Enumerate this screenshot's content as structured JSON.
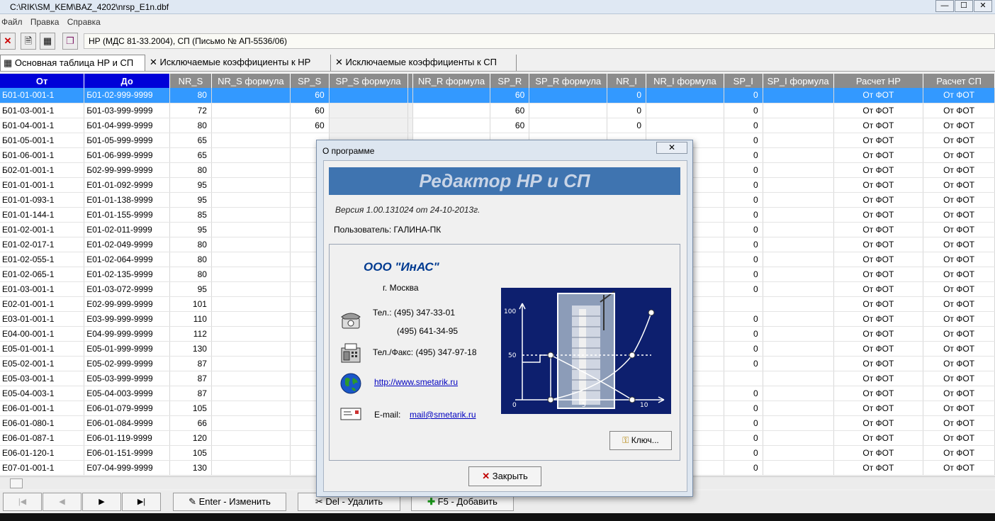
{
  "window": {
    "title": "C:\\RIK\\SM_KEM\\BAZ_4202\\nrsp_E1n.dbf"
  },
  "menu": [
    "Файл",
    "Правка",
    "Справка"
  ],
  "toolbar": {
    "field_value": "НР (МДС 81-33.2004), СП (Письмо № АП-5536/06)"
  },
  "tabs": [
    "Основная таблица НР и СП",
    "Исключаемые коэффициенты к НР",
    "Исключаемые коэффициенты к СП"
  ],
  "columns": [
    "От",
    "До",
    "NR_S",
    "NR_S формула",
    "SP_S",
    "SP_S формула",
    "NR_R формула",
    "SP_R",
    "SP_R формула",
    "NR_I",
    "NR_I формула",
    "SP_I",
    "SP_I формула",
    "Расчет НР",
    "Расчет СП"
  ],
  "rows": [
    {
      "from": "Б01-01-001-1",
      "to": "Б01-02-999-9999",
      "nrs": "80",
      "sps": "60",
      "spr": "60",
      "nri": "0",
      "spi": "0",
      "hr": "От ФОТ",
      "sp": "От ФОТ"
    },
    {
      "from": "Б01-03-001-1",
      "to": "Б01-03-999-9999",
      "nrs": "72",
      "sps": "60",
      "spr": "60",
      "nri": "0",
      "spi": "0",
      "hr": "От ФОТ",
      "sp": "От ФОТ"
    },
    {
      "from": "Б01-04-001-1",
      "to": "Б01-04-999-9999",
      "nrs": "80",
      "sps": "60",
      "spr": "60",
      "nri": "0",
      "spi": "0",
      "hr": "От ФОТ",
      "sp": "От ФОТ"
    },
    {
      "from": "Б01-05-001-1",
      "to": "Б01-05-999-9999",
      "nrs": "65",
      "sps": "",
      "spr": "",
      "nri": "",
      "spi": "0",
      "hr": "От ФОТ",
      "sp": "От ФОТ"
    },
    {
      "from": "Б01-06-001-1",
      "to": "Б01-06-999-9999",
      "nrs": "65",
      "sps": "",
      "spr": "",
      "nri": "",
      "spi": "0",
      "hr": "От ФОТ",
      "sp": "От ФОТ"
    },
    {
      "from": "Б02-01-001-1",
      "to": "Б02-99-999-9999",
      "nrs": "80",
      "sps": "",
      "spr": "",
      "nri": "",
      "spi": "0",
      "hr": "От ФОТ",
      "sp": "От ФОТ"
    },
    {
      "from": "Е01-01-001-1",
      "to": "Е01-01-092-9999",
      "nrs": "95",
      "sps": "",
      "spr": "",
      "nri": "",
      "spi": "0",
      "hr": "От ФОТ",
      "sp": "От ФОТ"
    },
    {
      "from": "Е01-01-093-1",
      "to": "Е01-01-138-9999",
      "nrs": "95",
      "sps": "",
      "spr": "",
      "nri": "",
      "spi": "0",
      "hr": "От ФОТ",
      "sp": "От ФОТ"
    },
    {
      "from": "Е01-01-144-1",
      "to": "Е01-01-155-9999",
      "nrs": "85",
      "sps": "",
      "spr": "",
      "nri": "",
      "spi": "0",
      "hr": "От ФОТ",
      "sp": "От ФОТ"
    },
    {
      "from": "Е01-02-001-1",
      "to": "Е01-02-011-9999",
      "nrs": "95",
      "sps": "",
      "spr": "",
      "nri": "",
      "spi": "0",
      "hr": "От ФОТ",
      "sp": "От ФОТ"
    },
    {
      "from": "Е01-02-017-1",
      "to": "Е01-02-049-9999",
      "nrs": "80",
      "sps": "",
      "spr": "",
      "nri": "",
      "spi": "0",
      "hr": "От ФОТ",
      "sp": "От ФОТ"
    },
    {
      "from": "Е01-02-055-1",
      "to": "Е01-02-064-9999",
      "nrs": "80",
      "sps": "",
      "spr": "",
      "nri": "",
      "spi": "0",
      "hr": "От ФОТ",
      "sp": "От ФОТ"
    },
    {
      "from": "Е01-02-065-1",
      "to": "Е01-02-135-9999",
      "nrs": "80",
      "sps": "",
      "spr": "",
      "nri": "",
      "spi": "0",
      "hr": "От ФОТ",
      "sp": "От ФОТ"
    },
    {
      "from": "Е01-03-001-1",
      "to": "Е01-03-072-9999",
      "nrs": "95",
      "sps": "",
      "spr": "",
      "nri": "",
      "spi": "0",
      "hr": "От ФОТ",
      "sp": "От ФОТ"
    },
    {
      "from": "Е02-01-001-1",
      "to": "Е02-99-999-9999",
      "nrs": "101",
      "sps": "",
      "spr": "",
      "nri": "",
      "spi": "",
      "hr": "От ФОТ",
      "sp": "От ФОТ"
    },
    {
      "from": "Е03-01-001-1",
      "to": "Е03-99-999-9999",
      "nrs": "110",
      "sps": "",
      "spr": "",
      "nri": "",
      "spi": "0",
      "hr": "От ФОТ",
      "sp": "От ФОТ"
    },
    {
      "from": "Е04-00-001-1",
      "to": "Е04-99-999-9999",
      "nrs": "112",
      "sps": "",
      "spr": "",
      "nri": "",
      "spi": "0",
      "hr": "От ФОТ",
      "sp": "От ФОТ"
    },
    {
      "from": "Е05-01-001-1",
      "to": "Е05-01-999-9999",
      "nrs": "130",
      "sps": "",
      "spr": "",
      "nri": "",
      "spi": "0",
      "hr": "От ФОТ",
      "sp": "От ФОТ"
    },
    {
      "from": "Е05-02-001-1",
      "to": "Е05-02-999-9999",
      "nrs": "87",
      "sps": "",
      "spr": "",
      "nri": "",
      "spi": "0",
      "hr": "От ФОТ",
      "sp": "От ФОТ"
    },
    {
      "from": "Е05-03-001-1",
      "to": "Е05-03-999-9999",
      "nrs": "87",
      "sps": "",
      "spr": "",
      "nri": "",
      "spi": "",
      "hr": "От ФОТ",
      "sp": "От ФОТ"
    },
    {
      "from": "Е05-04-003-1",
      "to": "Е05-04-003-9999",
      "nrs": "87",
      "sps": "",
      "spr": "",
      "nri": "",
      "spi": "0",
      "hr": "От ФОТ",
      "sp": "От ФОТ"
    },
    {
      "from": "Е06-01-001-1",
      "to": "Е06-01-079-9999",
      "nrs": "105",
      "sps": "",
      "spr": "",
      "nri": "",
      "spi": "0",
      "hr": "От ФОТ",
      "sp": "От ФОТ"
    },
    {
      "from": "Е06-01-080-1",
      "to": "Е06-01-084-9999",
      "nrs": "66",
      "sps": "",
      "spr": "",
      "nri": "",
      "spi": "0",
      "hr": "От ФОТ",
      "sp": "От ФОТ"
    },
    {
      "from": "Е06-01-087-1",
      "to": "Е06-01-119-9999",
      "nrs": "120",
      "sps": "",
      "spr": "",
      "nri": "",
      "spi": "0",
      "hr": "От ФОТ",
      "sp": "От ФОТ"
    },
    {
      "from": "Е06-01-120-1",
      "to": "Е06-01-151-9999",
      "nrs": "105",
      "sps": "",
      "spr": "",
      "nri": "",
      "spi": "0",
      "hr": "От ФОТ",
      "sp": "От ФОТ"
    },
    {
      "from": "Е07-01-001-1",
      "to": "Е07-04-999-9999",
      "nrs": "130",
      "sps": "",
      "spr": "",
      "nri": "",
      "spi": "0",
      "hr": "От ФОТ",
      "sp": "От ФОТ"
    }
  ],
  "bottom": {
    "edit_label": "Enter - Изменить",
    "delete_label": "Del - Удалить",
    "add_label": "F5 - Добавить"
  },
  "about": {
    "title": "О программе",
    "banner": "Редактор НР и СП",
    "version": "Версия 1.00.131024  от 24-10-2013г.",
    "user": "Пользователь: ГАЛИНА-ПК",
    "company": "ООО \"ИнАС\"",
    "city": "г. Москва",
    "phone_label": "Тел.: (495) 347-33-01",
    "phone2": "(495) 641-34-95",
    "fax_label": "Тел./Факс: (495) 347-97-18",
    "website": "http://www.smetarik.ru",
    "email_label": "E-mail:",
    "email": "mail@smetarik.ru",
    "key_button": "Ключ...",
    "close_button": "Закрыть",
    "graph_ticks": [
      "100",
      "50",
      "0",
      "5",
      "10"
    ]
  },
  "colors": {
    "header_gray": "#8c8c8c",
    "header_blue": "#0000d8",
    "selection": "#3399ff",
    "banner": "#3f74b0"
  }
}
